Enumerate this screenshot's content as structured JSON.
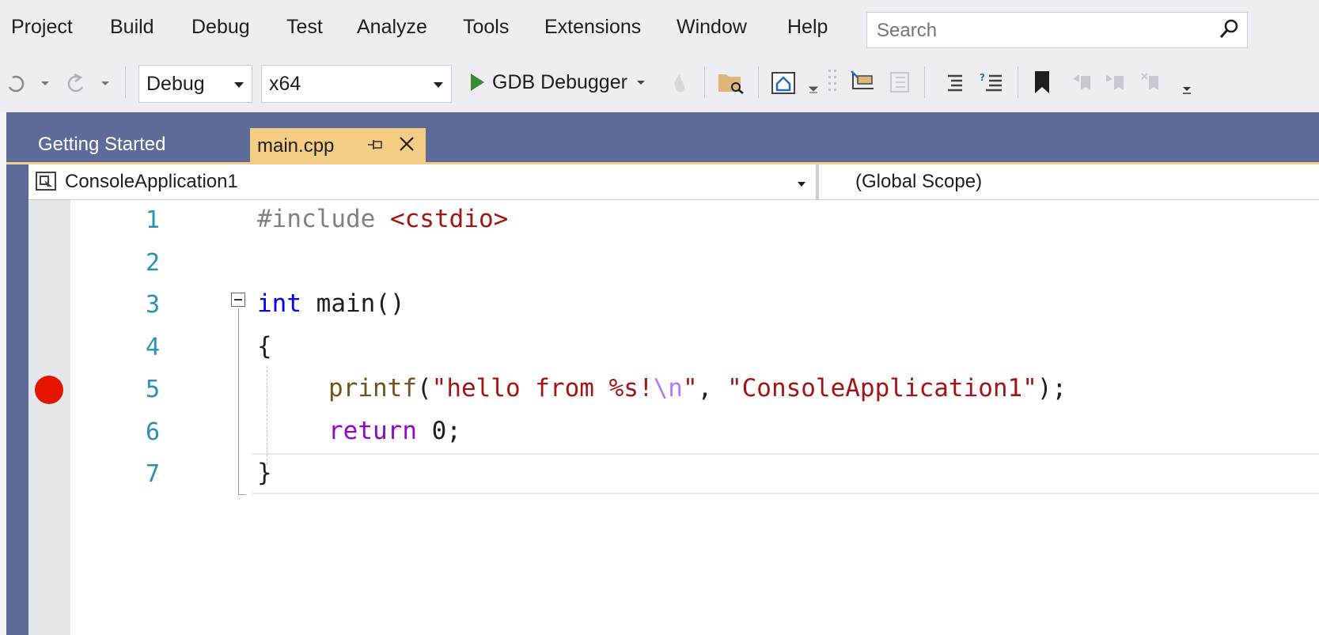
{
  "menu": {
    "items": [
      "Project",
      "Build",
      "Debug",
      "Test",
      "Analyze",
      "Tools",
      "Extensions",
      "Window",
      "Help"
    ],
    "search_placeholder": "Search"
  },
  "toolbar": {
    "configuration": "Debug",
    "platform": "x64",
    "debugger_label": "GDB Debugger",
    "icons": [
      "redo-icon",
      "undo-icon",
      "play-icon",
      "hot-reload-icon",
      "open-folder-icon",
      "home-icon",
      "solution-explorer-icon",
      "class-view-icon",
      "comment-icon",
      "uncomment-icon",
      "bookmark-icon",
      "prev-bookmark-icon",
      "next-bookmark-icon",
      "clear-bookmarks-icon"
    ]
  },
  "tabs": [
    {
      "label": "Getting Started",
      "active": false
    },
    {
      "label": "main.cpp",
      "active": true
    }
  ],
  "navigation": {
    "project": "ConsoleApplication1",
    "scope": "(Global Scope)"
  },
  "editor": {
    "line_numbers": [
      "1",
      "2",
      "3",
      "4",
      "5",
      "6",
      "7"
    ],
    "lines": {
      "l1_directive": "#include",
      "l1_header": "<cstdio>",
      "l3_type": "int",
      "l3_name": "main",
      "l3_parens": "()",
      "l4_brace": "{",
      "l5_fn": "printf",
      "l5_open": "(",
      "l5_str1a": "\"hello from %s!",
      "l5_esc": "\\n",
      "l5_str1b": "\"",
      "l5_comma": ", ",
      "l5_str2": "\"ConsoleApplication1\"",
      "l5_close": ");",
      "l6_kw": "return",
      "l6_rest": " 0;",
      "l7_brace": "}"
    },
    "breakpoint_line": 5
  },
  "colors": {
    "accent_tab": "#f5cc84",
    "frame": "#5d6b99",
    "breakpoint": "#e51400",
    "line_number": "#2b91af"
  }
}
